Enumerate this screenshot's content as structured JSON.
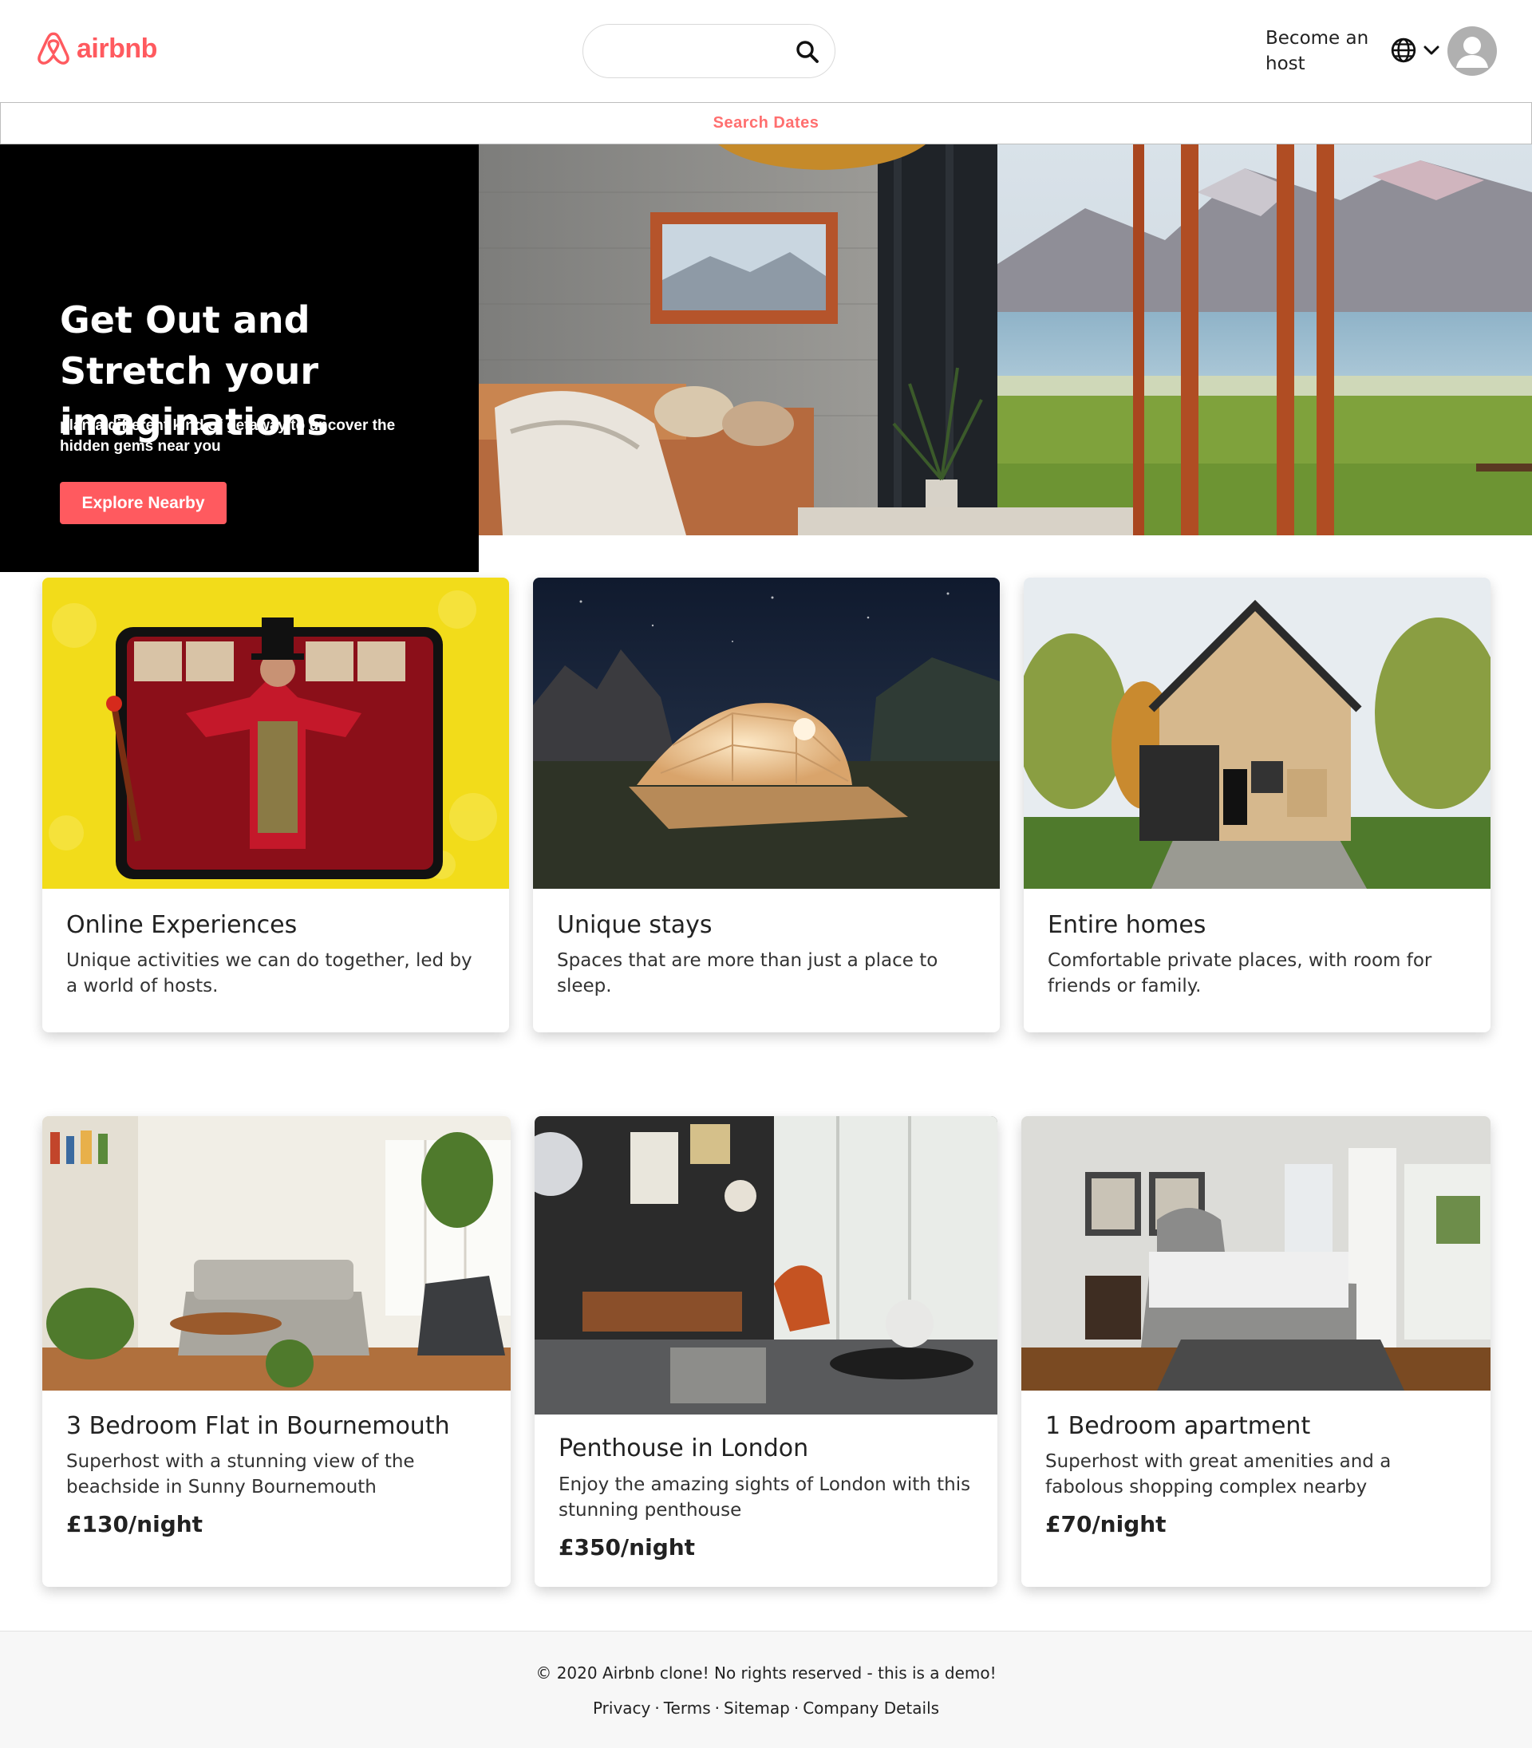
{
  "header": {
    "logo_text": "airbnb",
    "search": {
      "placeholder": "",
      "value": ""
    },
    "host_link": "Become an host",
    "icons": [
      "airbnb-logo-icon",
      "search-icon",
      "globe-icon",
      "chevron-down-icon",
      "user-avatar-icon"
    ]
  },
  "search_dates": {
    "label": "Search Dates"
  },
  "hero": {
    "title": "Get Out and Stretch your imaginations",
    "subtitle": "plan a different kind of getaway to uncover the hidden gems near you",
    "button": "Explore Nearby"
  },
  "categories": [
    {
      "title": "Online Experiences",
      "description": "Unique activities we can do together, led by a world of hosts."
    },
    {
      "title": "Unique stays",
      "description": "Spaces that are more than just a place to sleep."
    },
    {
      "title": "Entire homes",
      "description": "Comfortable private places, with room for friends or family."
    }
  ],
  "listings": [
    {
      "title": "3 Bedroom Flat in Bournemouth",
      "description": "Superhost with a stunning view of the beachside in Sunny Bournemouth",
      "price": "£130/night"
    },
    {
      "title": "Penthouse in London",
      "description": "Enjoy the amazing sights of London with this stunning penthouse",
      "price": "£350/night"
    },
    {
      "title": "1 Bedroom apartment",
      "description": "Superhost with great amenities and a fabolous shopping complex nearby",
      "price": "£70/night"
    }
  ],
  "footer": {
    "copyright": "© 2020 Airbnb clone! No rights reserved - this is a demo!",
    "links": [
      "Privacy",
      "Terms",
      "Sitemap",
      "Company Details"
    ],
    "separator": "·"
  },
  "colors": {
    "brand": "#ff5a5f",
    "dates_text": "#ff6f6f",
    "hero_bg": "#000000",
    "footer_bg": "#f7f7f7"
  }
}
